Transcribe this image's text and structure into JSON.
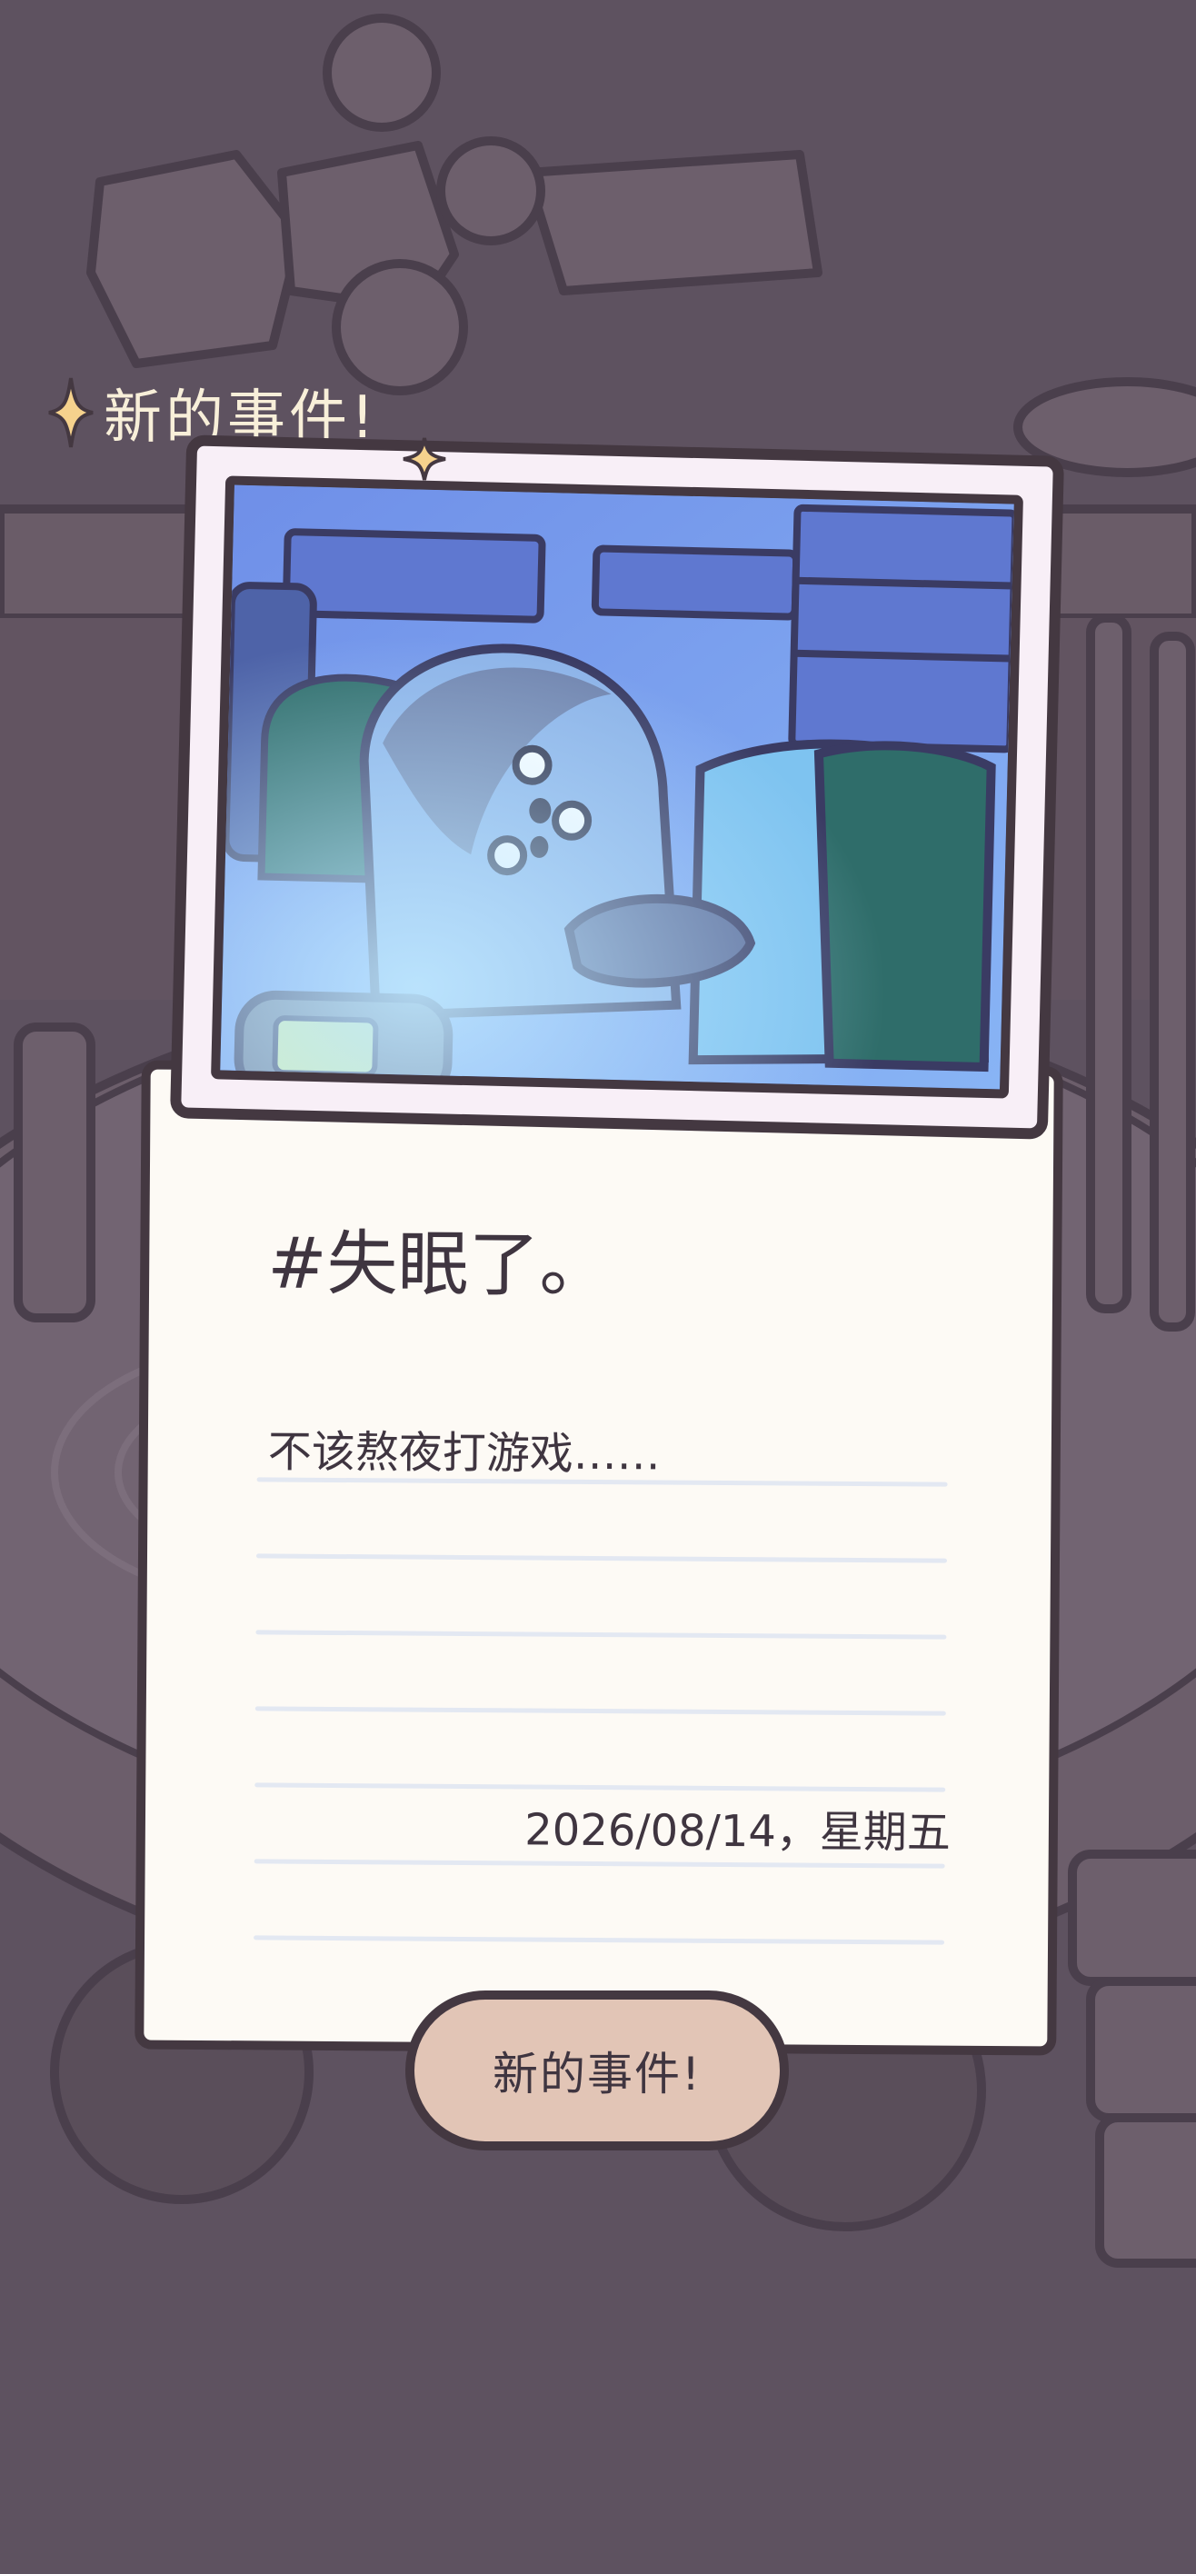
{
  "header": {
    "label": "新的事件!"
  },
  "event_card": {
    "title": "#失眠了。",
    "note": "不该熬夜打游戏……",
    "date": "2026/08/14，星期五"
  },
  "action": {
    "button_label": "新的事件!"
  },
  "colors": {
    "background": "#5e5260",
    "outline": "#443841",
    "paper": "#fdfaf5",
    "photo_frame": "#f8eff7",
    "button": "#e2c5b6",
    "sparkle": "#f6d28d",
    "header_text": "#f8efd9"
  },
  "icons": {
    "header_sparkle": "sparkle-icon",
    "small_sparkle": "sparkle-icon"
  }
}
